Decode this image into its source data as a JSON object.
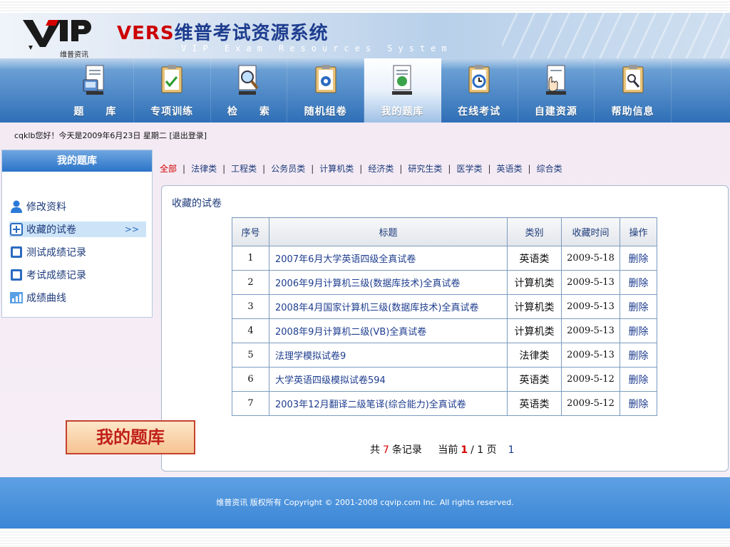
{
  "header": {
    "logo_text": "维普资讯",
    "brand_latin": "VERS",
    "brand_cn": "维普考试资源系统",
    "brand_sub": "VIP Exam Resources System"
  },
  "nav": [
    {
      "label": "题　　库",
      "icon": "question-bank-icon"
    },
    {
      "label": "专项训练",
      "icon": "training-clipboard-icon"
    },
    {
      "label": "检　　索",
      "icon": "search-magnifier-icon"
    },
    {
      "label": "随机组卷",
      "icon": "random-paper-icon"
    },
    {
      "label": "我的题库",
      "icon": "my-bank-icon",
      "active": true
    },
    {
      "label": "在线考试",
      "icon": "clock-exam-icon"
    },
    {
      "label": "自建资源",
      "icon": "hand-document-icon"
    },
    {
      "label": "帮助信息",
      "icon": "help-clipboard-icon"
    }
  ],
  "user": {
    "greeting": "cqklb您好！今天是2009年6月23日 星期二",
    "logout": "[退出登录]"
  },
  "sidebar": {
    "title": "我的题库",
    "items": [
      {
        "label": "修改资料",
        "icon": "user-icon"
      },
      {
        "label": "收藏的试卷",
        "icon": "plus-box-icon",
        "active": true,
        "arrow": ">>"
      },
      {
        "label": "测试成绩记录",
        "icon": "square-box-icon"
      },
      {
        "label": "考试成绩记录",
        "icon": "square-box-icon"
      },
      {
        "label": "成绩曲线",
        "icon": "bar-chart-icon"
      }
    ]
  },
  "categories": [
    "全部",
    "法律类",
    "工程类",
    "公务员类",
    "计算机类",
    "经济类",
    "研究生类",
    "医学类",
    "英语类",
    "综合类"
  ],
  "panel": {
    "title": "收藏的试卷",
    "columns": [
      "序号",
      "标题",
      "类别",
      "收藏时间",
      "操作"
    ],
    "rows": [
      {
        "no": "1",
        "title": "2007年6月大学英语四级全真试卷",
        "cat": "英语类",
        "date": "2009-5-18",
        "op": "删除"
      },
      {
        "no": "2",
        "title": "2006年9月计算机三级(数据库技术)全真试卷",
        "cat": "计算机类",
        "date": "2009-5-13",
        "op": "删除"
      },
      {
        "no": "3",
        "title": "2008年4月国家计算机三级(数据库技术)全真试卷",
        "cat": "计算机类",
        "date": "2009-5-13",
        "op": "删除"
      },
      {
        "no": "4",
        "title": "2008年9月计算机二级(VB)全真试卷",
        "cat": "计算机类",
        "date": "2009-5-13",
        "op": "删除"
      },
      {
        "no": "5",
        "title": "法理学模拟试卷9",
        "cat": "法律类",
        "date": "2009-5-13",
        "op": "删除"
      },
      {
        "no": "6",
        "title": "大学英语四级模拟试卷594",
        "cat": "英语类",
        "date": "2009-5-12",
        "op": "删除"
      },
      {
        "no": "7",
        "title": "2003年12月翻译二级笔译(综合能力)全真试卷",
        "cat": "英语类",
        "date": "2009-5-12",
        "op": "删除"
      }
    ],
    "pager": {
      "prefix": "共",
      "total": "7",
      "records_suffix": "条记录",
      "current_label": "当前",
      "current": "1",
      "pages": "/ 1 页",
      "page_link": "1"
    }
  },
  "stamp": "我的题库",
  "footer": "维普资讯 版权所有 Copyright © 2001-2008 cqvip.com Inc. All rights reserved.",
  "colors": {
    "brand_red": "#cc0000",
    "brand_blue": "#1e3d8f",
    "nav_blue": "#2f6fb7",
    "active_red": "#d40000"
  }
}
